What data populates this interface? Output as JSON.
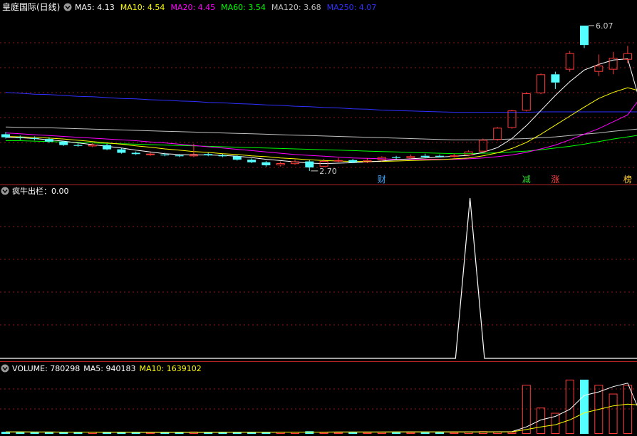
{
  "window": {
    "title": "皇庭国际(日线)"
  },
  "price_panel": {
    "ma_labels": [
      {
        "key": "ma5",
        "text": "MA5: 4.13",
        "color": "#ffffff"
      },
      {
        "key": "ma10",
        "text": "MA10: 4.54",
        "color": "#ffff00"
      },
      {
        "key": "ma20",
        "text": "MA20: 4.45",
        "color": "#ff00ff"
      },
      {
        "key": "ma60",
        "text": "MA60: 3.54",
        "color": "#00ff00"
      },
      {
        "key": "ma120",
        "text": "MA120: 3.68",
        "color": "#c0c0c0"
      },
      {
        "key": "ma250",
        "text": "MA250: 4.07",
        "color": "#3030ff"
      }
    ],
    "high_annotation": "6.07",
    "low_annotation": "2.70",
    "markers": [
      {
        "text": "财",
        "color": "#44aaff"
      },
      {
        "text": "减",
        "color": "#33dd33"
      },
      {
        "text": "涨",
        "color": "#ff4444"
      },
      {
        "text": "榜",
        "color": "#ffcc33"
      }
    ]
  },
  "indicator_panel": {
    "label": "疯牛出栏：0.00"
  },
  "volume_panel": {
    "labels": [
      {
        "text": "VOLUME: 780298",
        "color": "#ffffff"
      },
      {
        "text": "MA5: 940183",
        "color": "#ffffff"
      },
      {
        "text": "MA10: 1639102",
        "color": "#ffff00"
      }
    ]
  },
  "colors": {
    "up": "#ff3a3a",
    "down": "#54ffff",
    "grid": "#8b1a1a",
    "separator": "#b22222",
    "background": "#000000"
  },
  "chart_data": [
    {
      "type": "candlestick",
      "title": "皇庭国际(日线)",
      "ylim": [
        2.5,
        6.3
      ],
      "candles": [
        [
          3.55,
          3.48,
          3.6,
          3.45
        ],
        [
          3.48,
          3.46,
          3.52,
          3.42
        ],
        [
          3.46,
          3.45,
          3.5,
          3.41
        ],
        [
          3.44,
          3.38,
          3.48,
          3.35
        ],
        [
          3.38,
          3.3,
          3.4,
          3.28
        ],
        [
          3.3,
          3.28,
          3.34,
          3.26
        ],
        [
          3.27,
          3.31,
          3.35,
          3.25
        ],
        [
          3.3,
          3.2,
          3.33,
          3.18
        ],
        [
          3.2,
          3.12,
          3.23,
          3.1
        ],
        [
          3.12,
          3.09,
          3.15,
          3.07
        ],
        [
          3.07,
          3.1,
          3.13,
          3.05
        ],
        [
          3.08,
          3.06,
          3.12,
          3.04
        ],
        [
          3.06,
          3.04,
          3.09,
          3.02
        ],
        [
          3.04,
          3.09,
          3.33,
          3.02
        ],
        [
          3.09,
          3.06,
          3.12,
          3.04
        ],
        [
          3.06,
          3.04,
          3.09,
          3.02
        ],
        [
          3.04,
          2.96,
          3.06,
          2.94
        ],
        [
          2.96,
          2.9,
          2.99,
          2.88
        ],
        [
          2.9,
          2.83,
          2.93,
          2.8
        ],
        [
          2.83,
          2.88,
          2.92,
          2.8
        ],
        [
          2.86,
          2.92,
          2.96,
          2.84
        ],
        [
          2.92,
          2.78,
          2.95,
          2.7
        ],
        [
          2.8,
          2.93,
          2.98,
          2.78
        ],
        [
          2.93,
          2.95,
          3.0,
          2.9
        ],
        [
          2.95,
          2.9,
          2.98,
          2.88
        ],
        [
          2.9,
          2.95,
          3.0,
          2.88
        ],
        [
          2.95,
          3.02,
          3.04,
          2.92
        ],
        [
          3.02,
          3.0,
          3.05,
          2.96
        ],
        [
          3.0,
          3.04,
          3.08,
          2.98
        ],
        [
          3.05,
          3.02,
          3.1,
          3.0
        ],
        [
          3.05,
          3.03,
          3.08,
          3.01
        ],
        [
          3.03,
          3.06,
          3.1,
          3.01
        ],
        [
          3.06,
          3.15,
          3.18,
          3.04
        ],
        [
          3.15,
          3.42,
          3.45,
          3.13
        ],
        [
          3.42,
          3.7,
          3.72,
          3.4
        ],
        [
          3.7,
          4.1,
          4.12,
          3.68
        ],
        [
          4.1,
          4.5,
          4.52,
          4.08
        ],
        [
          4.5,
          4.94,
          4.96,
          4.48
        ],
        [
          4.94,
          4.75,
          5.0,
          4.6
        ],
        [
          5.05,
          5.43,
          5.48,
          5.0
        ],
        [
          6.07,
          5.62,
          6.07,
          5.55
        ],
        [
          5.0,
          5.14,
          5.4,
          4.9
        ],
        [
          5.05,
          5.32,
          5.46,
          4.94
        ],
        [
          5.28,
          5.43,
          5.6,
          5.2
        ],
        [
          5.28,
          5.12,
          5.4,
          5.02
        ]
      ],
      "ma5": [
        3.48,
        3.47,
        3.45,
        3.42,
        3.39,
        3.35,
        3.31,
        3.27,
        3.23,
        3.18,
        3.14,
        3.1,
        3.08,
        3.07,
        3.07,
        3.06,
        3.04,
        3.01,
        2.97,
        2.94,
        2.91,
        2.88,
        2.87,
        2.88,
        2.89,
        2.91,
        2.93,
        2.96,
        2.98,
        3.0,
        3.02,
        3.04,
        3.06,
        3.13,
        3.24,
        3.45,
        3.75,
        4.1,
        4.45,
        4.77,
        5.04,
        5.17,
        5.27,
        5.3,
        4.13
      ],
      "ma10": [
        3.5,
        3.49,
        3.48,
        3.46,
        3.44,
        3.41,
        3.38,
        3.35,
        3.32,
        3.28,
        3.25,
        3.21,
        3.18,
        3.15,
        3.13,
        3.1,
        3.08,
        3.05,
        3.03,
        3.0,
        2.98,
        2.96,
        2.94,
        2.93,
        2.92,
        2.92,
        2.92,
        2.93,
        2.94,
        2.95,
        2.96,
        2.98,
        3.0,
        3.05,
        3.12,
        3.22,
        3.36,
        3.55,
        3.76,
        3.97,
        4.18,
        4.38,
        4.52,
        4.63,
        4.54
      ],
      "ma20": [
        3.58,
        3.56,
        3.54,
        3.52,
        3.5,
        3.48,
        3.46,
        3.44,
        3.42,
        3.4,
        3.37,
        3.35,
        3.32,
        3.29,
        3.26,
        3.23,
        3.2,
        3.17,
        3.14,
        3.11,
        3.08,
        3.06,
        3.04,
        3.02,
        3.0,
        2.99,
        2.98,
        2.97,
        2.97,
        2.97,
        2.97,
        2.97,
        2.98,
        3.0,
        3.03,
        3.07,
        3.13,
        3.21,
        3.3,
        3.42,
        3.55,
        3.68,
        3.84,
        4.0,
        4.45
      ],
      "ma60": [
        3.4,
        3.4,
        3.39,
        3.38,
        3.37,
        3.36,
        3.35,
        3.34,
        3.33,
        3.32,
        3.31,
        3.3,
        3.29,
        3.28,
        3.27,
        3.26,
        3.25,
        3.24,
        3.23,
        3.22,
        3.21,
        3.2,
        3.19,
        3.18,
        3.17,
        3.16,
        3.15,
        3.14,
        3.13,
        3.12,
        3.11,
        3.1,
        3.1,
        3.11,
        3.12,
        3.14,
        3.16,
        3.19,
        3.23,
        3.27,
        3.32,
        3.38,
        3.44,
        3.49,
        3.54
      ],
      "ma120": [
        3.72,
        3.71,
        3.7,
        3.7,
        3.69,
        3.68,
        3.67,
        3.66,
        3.65,
        3.64,
        3.63,
        3.62,
        3.61,
        3.6,
        3.59,
        3.58,
        3.57,
        3.56,
        3.55,
        3.54,
        3.53,
        3.52,
        3.51,
        3.5,
        3.49,
        3.48,
        3.47,
        3.46,
        3.45,
        3.44,
        3.43,
        3.42,
        3.42,
        3.42,
        3.43,
        3.44,
        3.45,
        3.47,
        3.49,
        3.52,
        3.55,
        3.58,
        3.62,
        3.65,
        3.68
      ],
      "ma250": [
        4.52,
        4.5,
        4.48,
        4.47,
        4.45,
        4.43,
        4.42,
        4.4,
        4.38,
        4.37,
        4.35,
        4.34,
        4.32,
        4.31,
        4.29,
        4.28,
        4.26,
        4.25,
        4.23,
        4.22,
        4.2,
        4.19,
        4.17,
        4.16,
        4.14,
        4.13,
        4.11,
        4.1,
        4.09,
        4.08,
        4.07,
        4.06,
        4.06,
        4.06,
        4.06,
        4.06,
        4.06,
        4.07,
        4.07,
        4.07,
        4.07,
        4.07,
        4.07,
        4.07,
        4.07
      ],
      "high_label_index": 40,
      "low_label_index": 21,
      "marker_indices": [
        26,
        36,
        38,
        43
      ]
    },
    {
      "type": "line",
      "title": "疯牛出栏",
      "ylim": [
        0,
        1
      ],
      "values": [
        0,
        0,
        0,
        0,
        0,
        0,
        0,
        0,
        0,
        0,
        0,
        0,
        0,
        0,
        0,
        0,
        0,
        0,
        0,
        0,
        0,
        0,
        0,
        0,
        0,
        0,
        0,
        0,
        0,
        0,
        0,
        1,
        0,
        0,
        0,
        0,
        0,
        0,
        0,
        0,
        0,
        0,
        0,
        0,
        0
      ],
      "spike_x": [
        31.1,
        32.1,
        33.1
      ]
    },
    {
      "type": "bar",
      "title": "VOLUME",
      "ylim": [
        0,
        3300000
      ],
      "values": [
        120000,
        95000,
        100000,
        115000,
        105000,
        90000,
        110000,
        98000,
        85000,
        80000,
        92000,
        88000,
        90000,
        130000,
        85000,
        80000,
        100000,
        115000,
        95000,
        108000,
        112000,
        150000,
        98000,
        92000,
        118000,
        96000,
        105000,
        88000,
        95000,
        84000,
        90000,
        98000,
        120000,
        150000,
        130000,
        110000,
        2800000,
        1500000,
        1200000,
        3100000,
        3100000,
        2800000,
        2300000,
        2800000,
        2000000
      ],
      "up": [
        0,
        0,
        0,
        0,
        0,
        0,
        1,
        0,
        0,
        0,
        1,
        0,
        0,
        1,
        0,
        0,
        0,
        0,
        0,
        1,
        1,
        0,
        1,
        1,
        0,
        1,
        1,
        0,
        1,
        0,
        0,
        1,
        1,
        1,
        1,
        1,
        1,
        1,
        1,
        1,
        0,
        1,
        1,
        1,
        0
      ],
      "ma5": [
        110000,
        108000,
        106000,
        104000,
        103000,
        102000,
        100000,
        99000,
        98000,
        96000,
        95000,
        94000,
        93000,
        94000,
        95000,
        96000,
        97000,
        98000,
        99000,
        100000,
        101000,
        102000,
        103000,
        104000,
        105000,
        106000,
        107000,
        108000,
        109000,
        110000,
        111000,
        112000,
        113000,
        115000,
        118000,
        125000,
        400000,
        800000,
        1000000,
        1400000,
        2200000,
        2400000,
        2700000,
        2900000,
        940183
      ],
      "ma10": [
        110000,
        108000,
        106000,
        104000,
        103000,
        102000,
        100000,
        99000,
        98000,
        96000,
        95000,
        94000,
        93000,
        94000,
        95000,
        96000,
        97000,
        98000,
        99000,
        100000,
        101000,
        102000,
        103000,
        104000,
        105000,
        106000,
        107000,
        108000,
        109000,
        110000,
        111000,
        112000,
        113000,
        114000,
        115000,
        117000,
        250000,
        400000,
        520000,
        800000,
        1200000,
        1400000,
        1600000,
        1700000,
        1639102
      ]
    }
  ]
}
